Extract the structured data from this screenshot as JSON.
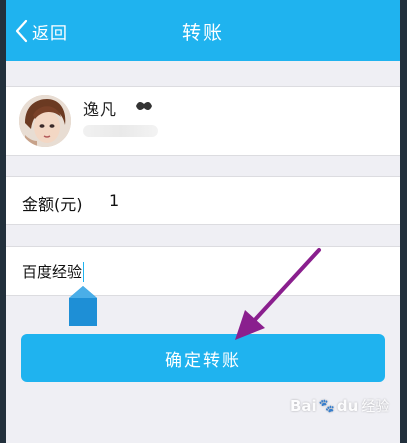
{
  "header": {
    "back_label": "返回",
    "title": "转账"
  },
  "recipient": {
    "name": "逸凡"
  },
  "amount": {
    "label": "金额(元)",
    "value": "1"
  },
  "note": {
    "value": "百度经验"
  },
  "confirm": {
    "label": "确定转账"
  },
  "watermark": {
    "brand_a": "Bai",
    "brand_b": "du",
    "suffix": "经验"
  },
  "colors": {
    "accent": "#1fb3ef",
    "annotation_arrow": "#8a1f8e",
    "background": "#efeff4"
  }
}
